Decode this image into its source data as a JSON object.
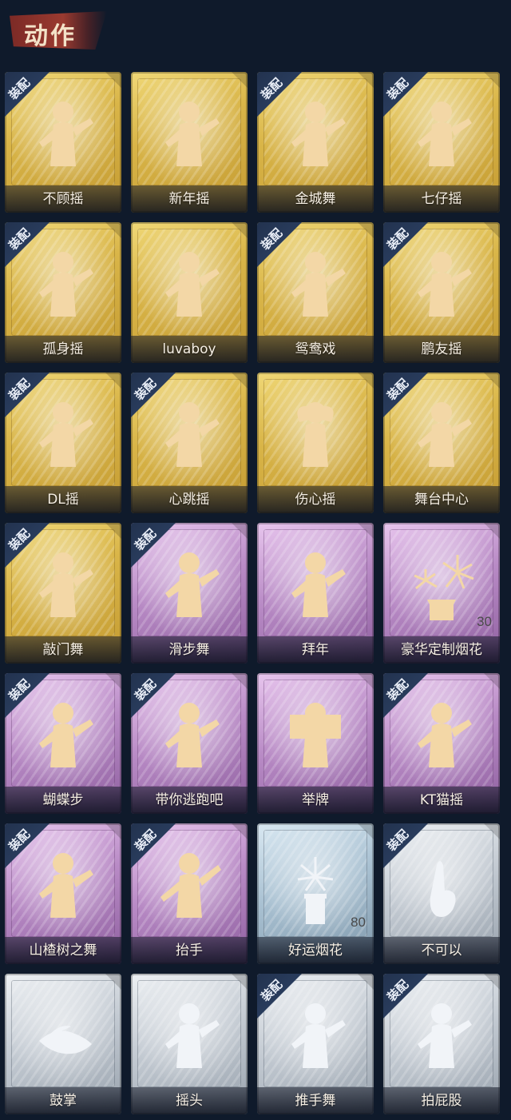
{
  "header": {
    "title": "动作"
  },
  "cards": [
    {
      "label": "不顾摇",
      "tier": "gold",
      "equipped": true,
      "icon": "dance-figure-icon"
    },
    {
      "label": "新年摇",
      "tier": "gold",
      "equipped": false,
      "icon": "dance-figure-icon"
    },
    {
      "label": "金城舞",
      "tier": "gold",
      "equipped": true,
      "icon": "dance-figure-icon"
    },
    {
      "label": "七仔摇",
      "tier": "gold",
      "equipped": true,
      "icon": "dance-figure-icon"
    },
    {
      "label": "孤身摇",
      "tier": "gold",
      "equipped": true,
      "icon": "dance-figure-icon"
    },
    {
      "label": "luvaboy",
      "tier": "gold",
      "equipped": false,
      "icon": "dance-figure-icon"
    },
    {
      "label": "鸳鸯戏",
      "tier": "gold",
      "equipped": true,
      "icon": "dance-figure-icon"
    },
    {
      "label": "鹏友摇",
      "tier": "gold",
      "equipped": true,
      "icon": "dance-figure-icon"
    },
    {
      "label": "DL摇",
      "tier": "gold",
      "equipped": true,
      "icon": "dance-figure-icon"
    },
    {
      "label": "心跳摇",
      "tier": "gold",
      "equipped": true,
      "icon": "dance-figure-icon"
    },
    {
      "label": "伤心摇",
      "tier": "gold",
      "equipped": false,
      "icon": "heart-hands-icon"
    },
    {
      "label": "舞台中心",
      "tier": "gold",
      "equipped": true,
      "icon": "dance-figure-icon"
    },
    {
      "label": "敲门舞",
      "tier": "gold",
      "equipped": true,
      "icon": "dance-figure-icon"
    },
    {
      "label": "滑步舞",
      "tier": "purple",
      "equipped": true,
      "icon": "dance-figure-icon"
    },
    {
      "label": "拜年",
      "tier": "purple",
      "equipped": false,
      "icon": "bow-figure-icon"
    },
    {
      "label": "豪华定制烟花",
      "tier": "purple",
      "equipped": false,
      "icon": "fireworks-box-icon",
      "count": "30"
    },
    {
      "label": "蝴蝶步",
      "tier": "purple",
      "equipped": true,
      "icon": "dance-figure-icon"
    },
    {
      "label": "带你逃跑吧",
      "tier": "purple",
      "equipped": true,
      "icon": "dance-figure-icon"
    },
    {
      "label": "举牌",
      "tier": "purple",
      "equipped": false,
      "icon": "sign-holder-icon"
    },
    {
      "label": "KT猫摇",
      "tier": "purple",
      "equipped": true,
      "icon": "dance-figure-icon"
    },
    {
      "label": "山楂树之舞",
      "tier": "purple",
      "equipped": true,
      "icon": "dance-figure-icon"
    },
    {
      "label": "抬手",
      "tier": "purple",
      "equipped": true,
      "icon": "raise-hand-icon"
    },
    {
      "label": "好运烟花",
      "tier": "blue",
      "equipped": false,
      "icon": "fireworks-canister-icon",
      "count": "80"
    },
    {
      "label": "不可以",
      "tier": "silver",
      "equipped": true,
      "icon": "finger-wag-icon"
    },
    {
      "label": "鼓掌",
      "tier": "silver",
      "equipped": false,
      "icon": "clap-icon"
    },
    {
      "label": "摇头",
      "tier": "silver",
      "equipped": false,
      "icon": "shake-head-icon"
    },
    {
      "label": "推手舞",
      "tier": "silver",
      "equipped": true,
      "icon": "push-hands-icon"
    },
    {
      "label": "拍屁股",
      "tier": "silver",
      "equipped": true,
      "icon": "slap-icon"
    }
  ],
  "badge_label": "装配"
}
